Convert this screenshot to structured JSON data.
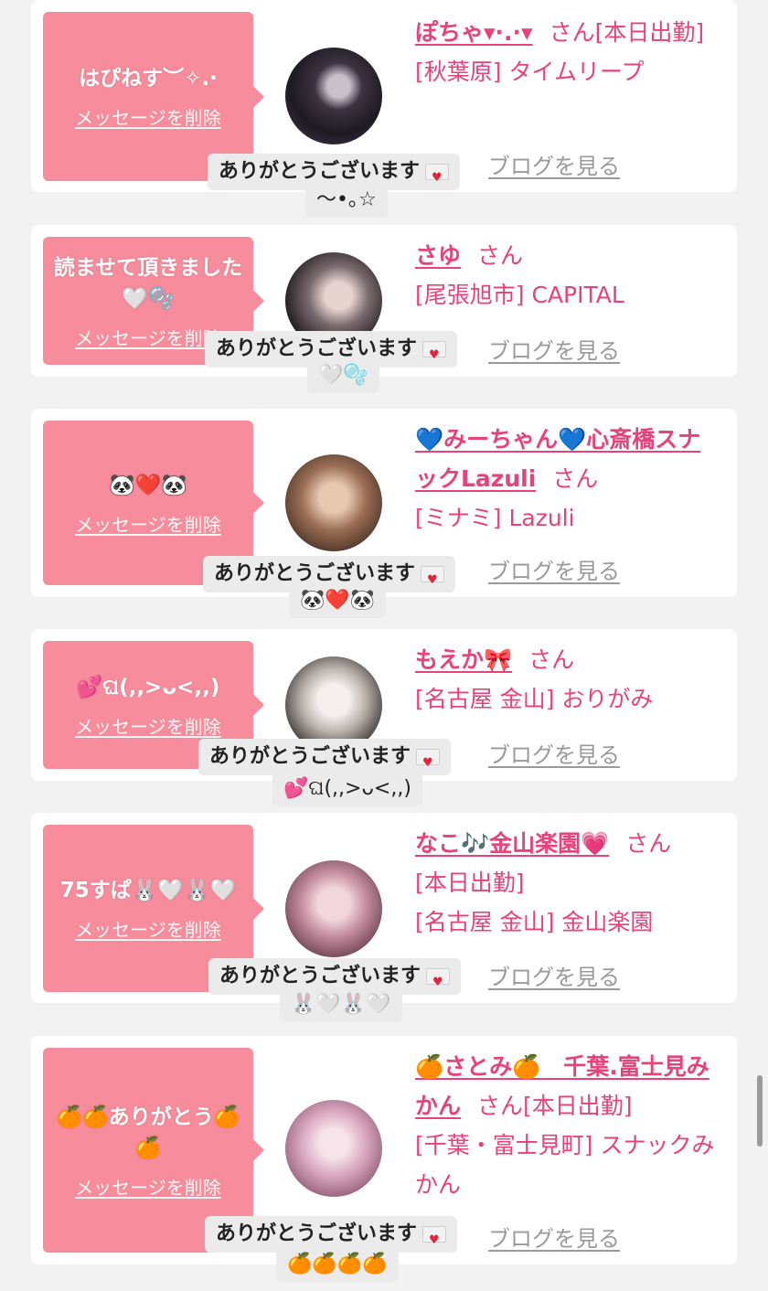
{
  "delete_label": "メッセージを削除",
  "blog_label": "ブログを見る",
  "san_label": "さん",
  "thanks_label": "ありがとうございます",
  "cards": [
    {
      "message": "はぴねす︶✧.·",
      "name": "ぽちゃ▾·.·▾",
      "status": "[本日出勤]",
      "area": "[秋葉原] タイムリープ",
      "thanks_sub": "〜•｡☆"
    },
    {
      "message": "読ませて頂きました🤍🫧",
      "name": "さゆ",
      "status": "",
      "area": "[尾張旭市] CAPITAL",
      "thanks_sub": "🤍🫧"
    },
    {
      "message": "🐼❤️🐼",
      "name": "💙みーちゃん💙心斎橋スナックLazuli",
      "status": "",
      "area": "[ミナミ] Lazuli",
      "thanks_sub": "🐼❤️🐼"
    },
    {
      "message": "💕ଘ(,,>ᴗ<,,)",
      "name": "もえか🎀",
      "status": "",
      "area": "[名古屋 金山] おりがみ",
      "thanks_sub": "💕ଘ(,,>ᴗ<,,)"
    },
    {
      "message": "75すぱ🐰🤍🐰🤍",
      "name": "なこ🎶金山楽園💗",
      "status": "[本日出勤]",
      "area": "[名古屋 金山] 金山楽園",
      "thanks_sub": "🐰🤍🐰🤍"
    },
    {
      "message": "🍊🍊ありがとう🍊🍊",
      "name": "🍊さとみ🍊　千葉.富士見みかん",
      "status": "[本日出勤]",
      "area": "[千葉・富士見町] スナックみかん",
      "thanks_sub": "🍊🍊🍊🍊"
    }
  ],
  "colors": {
    "accent": "#e8427a",
    "bubble": "#f78d9c",
    "background": "#f2f2f2"
  }
}
